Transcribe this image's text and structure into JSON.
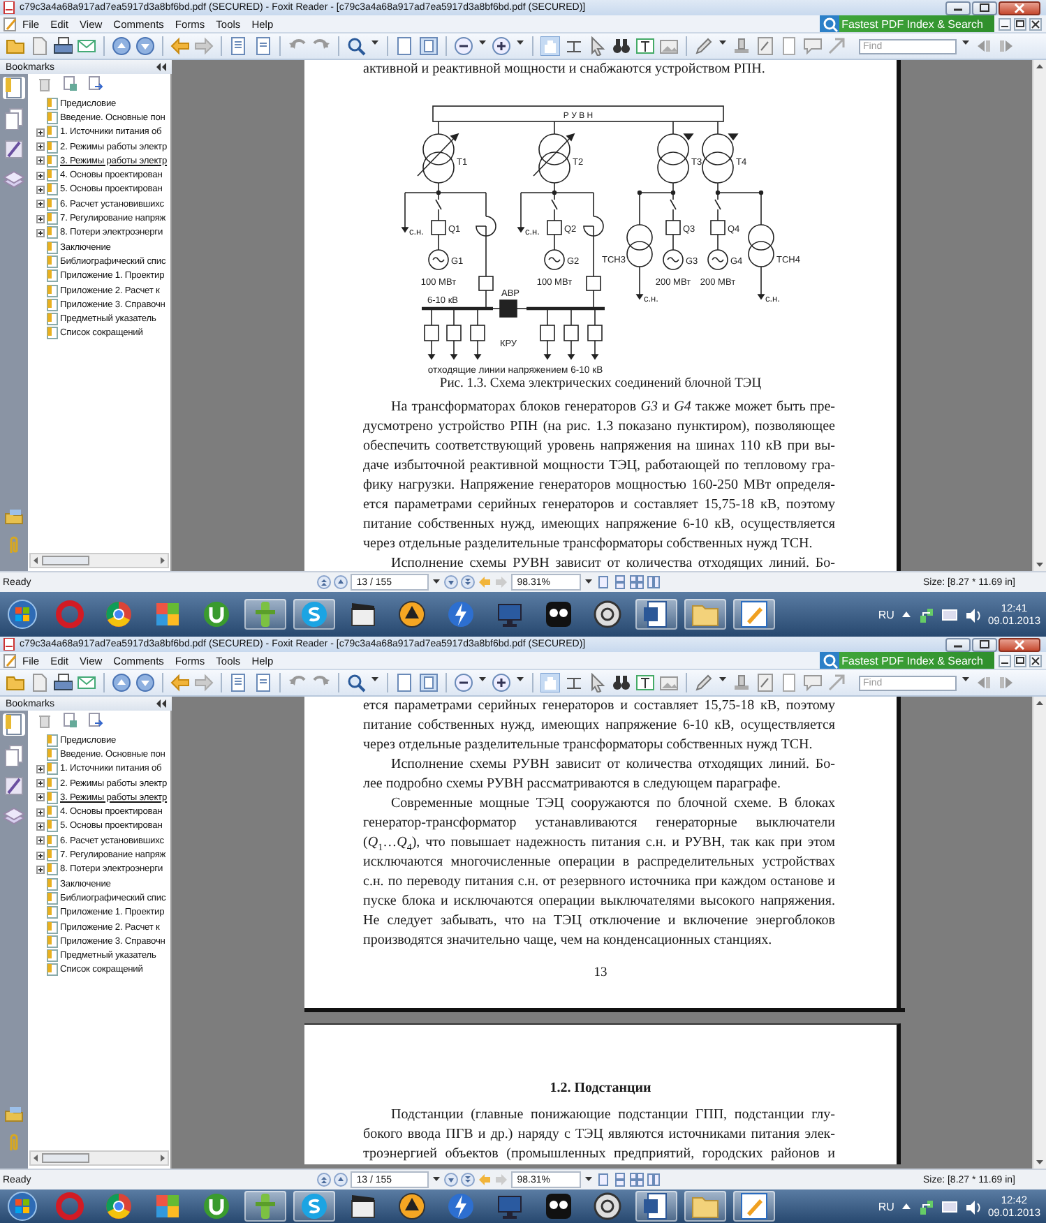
{
  "windows": [
    {
      "title": "c79c3a4a68a917ad7ea5917d3a8bf6bd.pdf (SECURED) - Foxit Reader - [c79c3a4a68a917ad7ea5917d3a8bf6bd.pdf (SECURED)]",
      "menu": [
        "File",
        "Edit",
        "View",
        "Comments",
        "Forms",
        "Tools",
        "Help"
      ],
      "promo": "Fastest PDF Index & Search",
      "find_placeholder": "Find",
      "bookmarks": {
        "title": "Bookmarks",
        "items": [
          {
            "label": "Предисловие",
            "kind": "leaf",
            "selected": false
          },
          {
            "label": "Введение. Основные пон",
            "kind": "leaf",
            "selected": false
          },
          {
            "label": "1. Источники питания об",
            "kind": "branch",
            "selected": false
          },
          {
            "label": "2. Режимы работы электр",
            "kind": "branch",
            "selected": false
          },
          {
            "label": "3. Режимы работы электр",
            "kind": "branch",
            "selected": true
          },
          {
            "label": "4. Основы проектирован",
            "kind": "branch",
            "selected": false
          },
          {
            "label": "5. Основы проектирован",
            "kind": "branch",
            "selected": false
          },
          {
            "label": "6. Расчет установившихс",
            "kind": "branch",
            "selected": false
          },
          {
            "label": "7. Регулирование напряж",
            "kind": "branch",
            "selected": false
          },
          {
            "label": "8. Потери электроэнерги",
            "kind": "branch",
            "selected": false
          },
          {
            "label": "Заключение",
            "kind": "leaf",
            "selected": false
          },
          {
            "label": "Библиографический спис",
            "kind": "leaf",
            "selected": false
          },
          {
            "label": "Приложение 1. Проектир",
            "kind": "leaf",
            "selected": false
          },
          {
            "label": "Приложение 2. Расчет к",
            "kind": "leaf",
            "selected": false
          },
          {
            "label": "Приложение 3. Справочн",
            "kind": "leaf",
            "selected": false
          },
          {
            "label": "Предметный указатель",
            "kind": "leaf",
            "selected": false
          },
          {
            "label": "Список сокращений",
            "kind": "leaf",
            "selected": false
          }
        ]
      },
      "pages": [
        {
          "blocks": [
            {
              "kind": "paragraph",
              "indent": false,
              "complete": true,
              "lines": [
                "активной и реактивной мощности и снабжаются устройством РПН."
              ]
            },
            {
              "kind": "figure",
              "diagram": {
                "switchyard": "Р У В Н",
                "bus_voltage": "6-10 кВ",
                "transfer": "АВР",
                "switchgear": "КРУ",
                "feeders": "отходящие линии напряжением 6-10 кВ",
                "units": [
                  {
                    "kind": "reactor",
                    "transformer": "T1",
                    "breaker": "Q1",
                    "generator": "G1",
                    "power": "100 МВт",
                    "aux": "с.н."
                  },
                  {
                    "kind": "reactor",
                    "transformer": "T2",
                    "breaker": "Q2",
                    "generator": "G2",
                    "power": "100 МВт",
                    "aux": "с.н."
                  },
                  {
                    "kind": "auxiliary",
                    "transformer": "T3",
                    "breaker": "Q3",
                    "generator": "G3",
                    "power": "200 МВт",
                    "aux": "с.н.",
                    "tsn": "ТСН3"
                  },
                  {
                    "kind": "auxiliary",
                    "transformer": "T4",
                    "breaker": "Q4",
                    "generator": "G4",
                    "power": "200 МВт",
                    "aux": "с.н.",
                    "tsn": "ТСН4"
                  }
                ]
              }
            },
            {
              "kind": "caption",
              "text": "Рис. 1.3. Схема электрических соединений блочной ТЭЦ"
            },
            {
              "kind": "paragraph",
              "indent": true,
              "complete": true,
              "lines": [
                "На трансформаторах блоков генераторов *G3* и *G4* также может быть пре-",
                "дусмотрено устройство РПН (на рис. 1.3 показано пунктиром), позволяющее",
                "обеспечить соответствующий уровень напряжения на шинах 110 кВ при вы-",
                "даче избыточной реактивной мощности ТЭЦ, работающей по тепловому гра-",
                "фику нагрузки. Напряжение генераторов мощностью 160-250 МВт определя-",
                "ется параметрами серийных генераторов и составляет 15,75-18 кВ, поэтому",
                "питание собственных нужд, имеющих напряжение 6-10 кВ, осуществляется",
                "через отдельные разделительные трансформаторы собственных нужд ТСН."
              ]
            },
            {
              "kind": "paragraph",
              "indent": true,
              "complete": false,
              "lines": [
                "Исполнение схемы РУВН зависит от количества отходящих линий. Бо-"
              ]
            }
          ]
        }
      ],
      "status": {
        "text": "Ready",
        "page": "13 / 155",
        "zoom": "98.31%",
        "size": "Size: [8.27 * 11.69 in]"
      },
      "taskbar": {
        "language": "RU",
        "time": "12:41",
        "date": "09.01.2013"
      }
    },
    {
      "title": "c79c3a4a68a917ad7ea5917d3a8bf6bd.pdf (SECURED) - Foxit Reader - [c79c3a4a68a917ad7ea5917d3a8bf6bd.pdf (SECURED)]",
      "menu": [
        "File",
        "Edit",
        "View",
        "Comments",
        "Forms",
        "Tools",
        "Help"
      ],
      "promo": "Fastest PDF Index & Search",
      "find_placeholder": "Find",
      "bookmarks": {
        "title": "Bookmarks",
        "items": [
          {
            "label": "Предисловие",
            "kind": "leaf",
            "selected": false
          },
          {
            "label": "Введение. Основные пон",
            "kind": "leaf",
            "selected": false
          },
          {
            "label": "1. Источники питания об",
            "kind": "branch",
            "selected": false
          },
          {
            "label": "2. Режимы работы электр",
            "kind": "branch",
            "selected": false
          },
          {
            "label": "3. Режимы работы электр",
            "kind": "branch",
            "selected": true
          },
          {
            "label": "4. Основы проектирован",
            "kind": "branch",
            "selected": false
          },
          {
            "label": "5. Основы проектирован",
            "kind": "branch",
            "selected": false
          },
          {
            "label": "6. Расчет установившихс",
            "kind": "branch",
            "selected": false
          },
          {
            "label": "7. Регулирование напряж",
            "kind": "branch",
            "selected": false
          },
          {
            "label": "8. Потери электроэнерги",
            "kind": "branch",
            "selected": false
          },
          {
            "label": "Заключение",
            "kind": "leaf",
            "selected": false
          },
          {
            "label": "Библиографический спис",
            "kind": "leaf",
            "selected": false
          },
          {
            "label": "Приложение 1. Проектир",
            "kind": "leaf",
            "selected": false
          },
          {
            "label": "Приложение 2. Расчет к",
            "kind": "leaf",
            "selected": false
          },
          {
            "label": "Приложение 3. Справочн",
            "kind": "leaf",
            "selected": false
          },
          {
            "label": "Предметный указатель",
            "kind": "leaf",
            "selected": false
          },
          {
            "label": "Список сокращений",
            "kind": "leaf",
            "selected": false
          }
        ]
      },
      "pages": [
        {
          "blocks": [
            {
              "kind": "paragraph",
              "indent": false,
              "complete": true,
              "lines": [
                "ется параметрами серийных генераторов и составляет 15,75-18 кВ, поэтому",
                "питание собственных нужд, имеющих напряжение 6-10 кВ, осуществляется",
                "через отдельные разделительные трансформаторы собственных нужд ТСН."
              ]
            },
            {
              "kind": "paragraph",
              "indent": true,
              "complete": true,
              "lines": [
                "Исполнение схемы РУВН зависит от количества отходящих линий. Бо-",
                "лее подробно схемы РУВН рассматриваются в следующем параграфе."
              ]
            },
            {
              "kind": "paragraph",
              "indent": true,
              "complete": true,
              "lines": [
                "Современные мощные ТЭЦ сооружаются по блочной схеме. В блоках",
                "генератор-трансформатор устанавливаются генераторные выключатели",
                "(*Q*$_{1}$…*Q*$_{4}$), что повышает надежность питания с.н. и РУВН, так как при этом",
                "исключаются многочисленные операции в распределительных устройствах",
                "с.н. по переводу питания с.н. от резервного источника при каждом останове и",
                "пуске блока и исключаются операции выключателями высокого напряжения.",
                "Не следует забывать, что на ТЭЦ отключение и включение энергоблоков",
                "производятся значительно чаще, чем на конденсационных станциях."
              ]
            },
            {
              "kind": "page-number",
              "text": "13"
            }
          ]
        },
        {
          "blocks": [
            {
              "kind": "heading",
              "text": "1.2. Подстанции"
            },
            {
              "kind": "paragraph",
              "indent": true,
              "complete": false,
              "lines": [
                "Подстанции (главные понижающие подстанции ГПП, подстанции глу-",
                "бокого ввода ПГВ и др.) наряду с ТЭЦ являются источниками питания элек-",
                "троэнергией объектов (промышленных предприятий, городских районов и"
              ]
            }
          ]
        }
      ],
      "status": {
        "text": "Ready",
        "page": "13 / 155",
        "zoom": "98.31%",
        "size": "Size: [8.27 * 11.69 in]"
      },
      "taskbar": {
        "language": "RU",
        "time": "12:42",
        "date": "09.01.2013"
      }
    }
  ]
}
